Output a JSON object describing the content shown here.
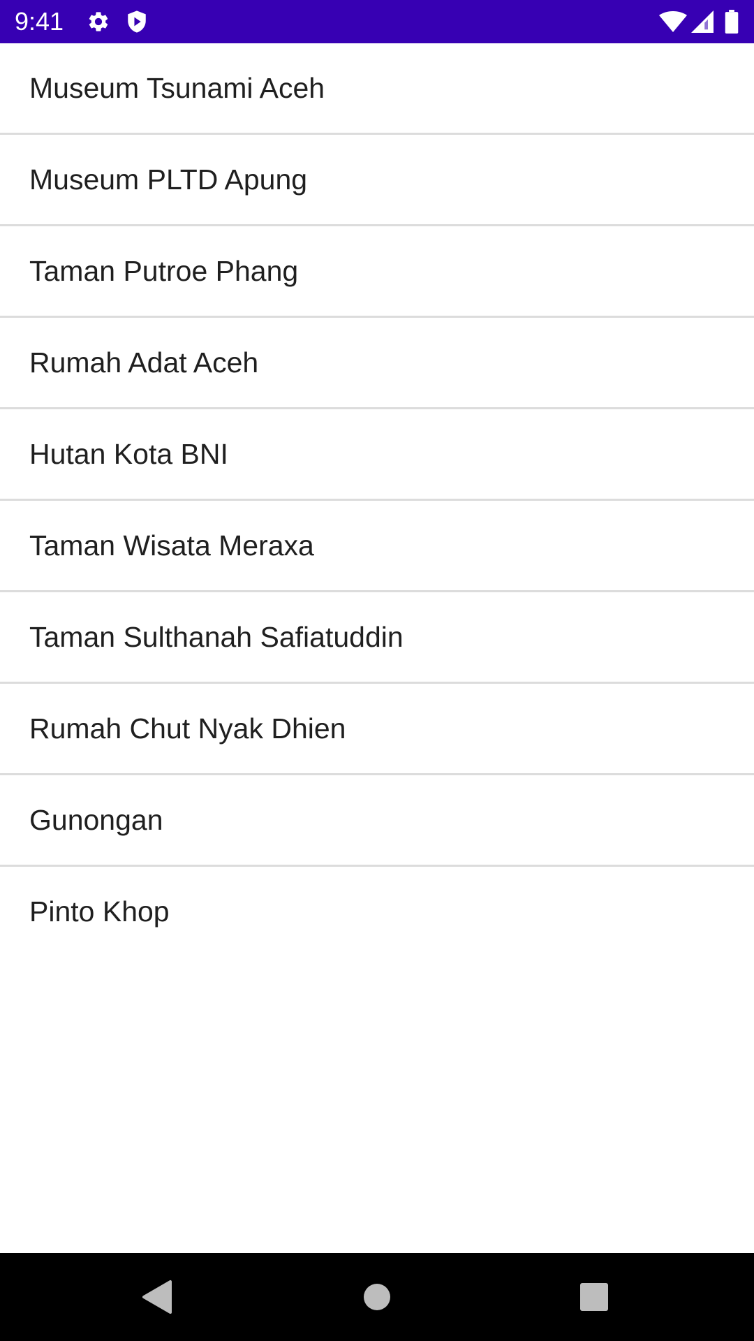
{
  "status_bar": {
    "time": "9:41",
    "background_color": "#3700b3",
    "icons_left": [
      "gear-icon",
      "shield-icon"
    ],
    "icons_right": [
      "wifi-icon",
      "signal-icon",
      "battery-icon"
    ]
  },
  "list": {
    "items": [
      {
        "label": "Museum Tsunami Aceh"
      },
      {
        "label": "Museum PLTD Apung"
      },
      {
        "label": "Taman Putroe Phang"
      },
      {
        "label": "Rumah Adat Aceh"
      },
      {
        "label": "Hutan Kota BNI"
      },
      {
        "label": "Taman Wisata Meraxa"
      },
      {
        "label": "Taman Sulthanah Safiatuddin"
      },
      {
        "label": "Rumah Chut Nyak Dhien"
      },
      {
        "label": "Gunongan"
      },
      {
        "label": "Pinto Khop"
      }
    ]
  },
  "nav_bar": {
    "buttons": [
      "back-icon",
      "home-icon",
      "recents-icon"
    ]
  }
}
